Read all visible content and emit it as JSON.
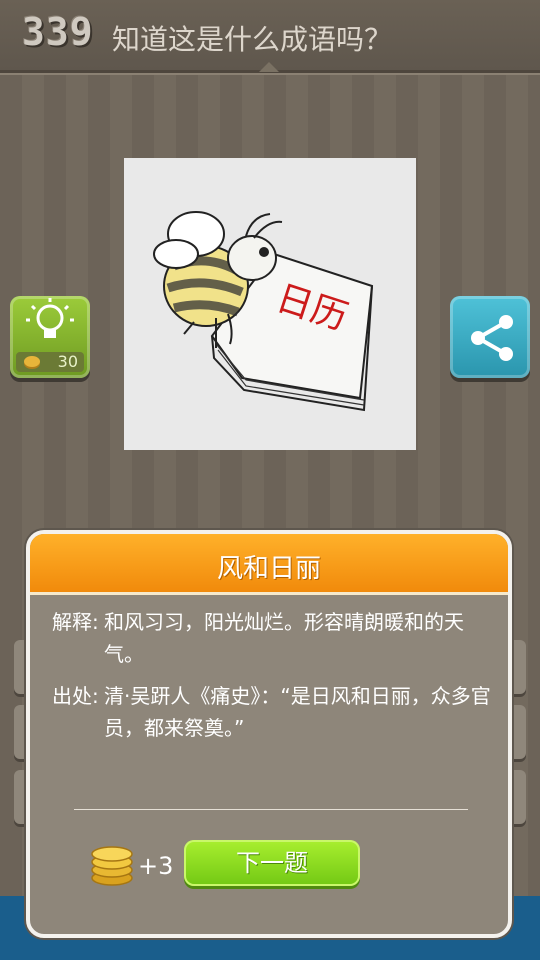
{
  "header": {
    "level": "339",
    "question": "知道这是什么成语吗？"
  },
  "puzzle_image": {
    "description_icon": "bee-on-calendar-icon",
    "calendar_text": "日历"
  },
  "hint_button": {
    "cost": "30",
    "icon": "lightbulb-icon"
  },
  "share_button": {
    "icon": "share-icon"
  },
  "dialog": {
    "title": "风和日丽",
    "explanation_label": "解释:",
    "explanation_text": "和风习习，阳光灿烂。形容晴朗暖和的天气。",
    "source_label": "出处:",
    "source_text": "清·吴趼人《痛史》：“是日风和日丽，众多官员，都来祭奠。”",
    "reward": "+3",
    "next_label": "下一题"
  },
  "colors": {
    "accent_orange": "#f18a0b",
    "next_green": "#72c814",
    "share_blue": "#2a95ad",
    "hint_green": "#6e9a22"
  }
}
